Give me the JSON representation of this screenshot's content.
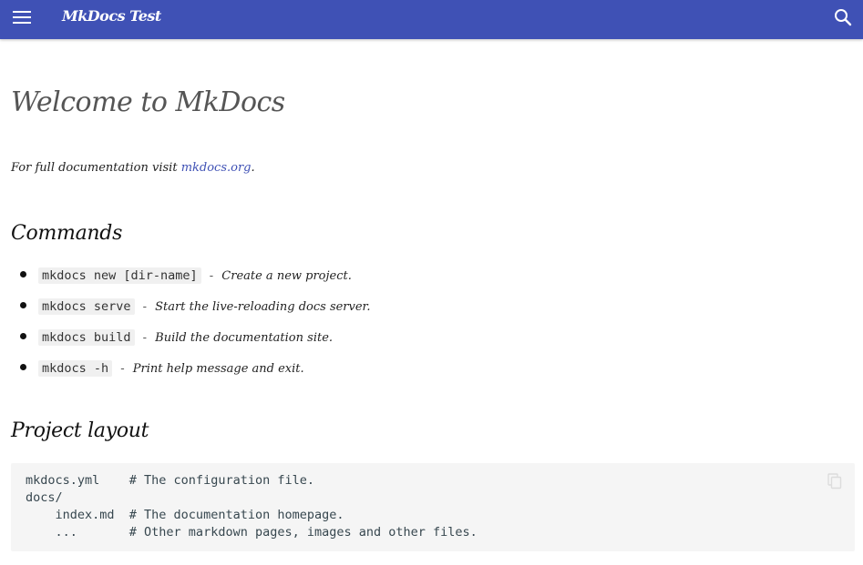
{
  "header": {
    "site_title": "MkDocs Test",
    "menu_icon": "menu-icon",
    "search_icon": "search-icon",
    "color": "#3f51b5"
  },
  "page": {
    "title": "Welcome to MkDocs",
    "intro_text": "For full documentation visit ",
    "intro_link": "mkdocs.org",
    "intro_end": ".",
    "commands_heading": "Commands",
    "commands": [
      {
        "code": "mkdocs new [dir-name]",
        "sep": "-",
        "desc": "Create a new project."
      },
      {
        "code": "mkdocs serve",
        "sep": "-",
        "desc": "Start the live-reloading docs server."
      },
      {
        "code": "mkdocs build",
        "sep": "-",
        "desc": "Build the documentation site."
      },
      {
        "code": "mkdocs -h",
        "sep": "-",
        "desc": "Print help message and exit."
      }
    ],
    "layout_heading": "Project layout",
    "layout_code": [
      "mkdocs.yml    # The configuration file.",
      "docs/",
      "    index.md  # The documentation homepage.",
      "    ...       # Other markdown pages, images and other files."
    ],
    "copy_icon": "copy-icon"
  }
}
